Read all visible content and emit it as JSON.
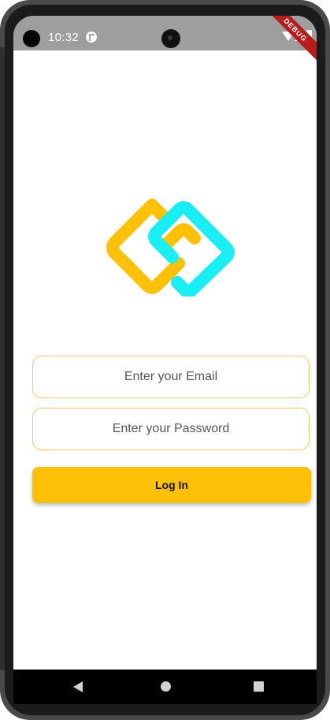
{
  "status_bar": {
    "time": "10:32",
    "debug_label": "DEBUG"
  },
  "login_form": {
    "email_placeholder": "Enter your Email",
    "password_placeholder": "Enter your Password",
    "login_label": "Log In"
  },
  "colors": {
    "accent": "#ffc107",
    "logo_yellow": "#ffc107",
    "logo_cyan": "#19eef5",
    "field_border": "#f2c766"
  },
  "icons": {
    "status_app": "app-notification-icon",
    "wifi": "wifi-icon",
    "signal": "signal-icon",
    "battery": "battery-icon",
    "back": "back-triangle-icon",
    "home": "home-circle-icon",
    "recents": "recents-square-icon"
  }
}
